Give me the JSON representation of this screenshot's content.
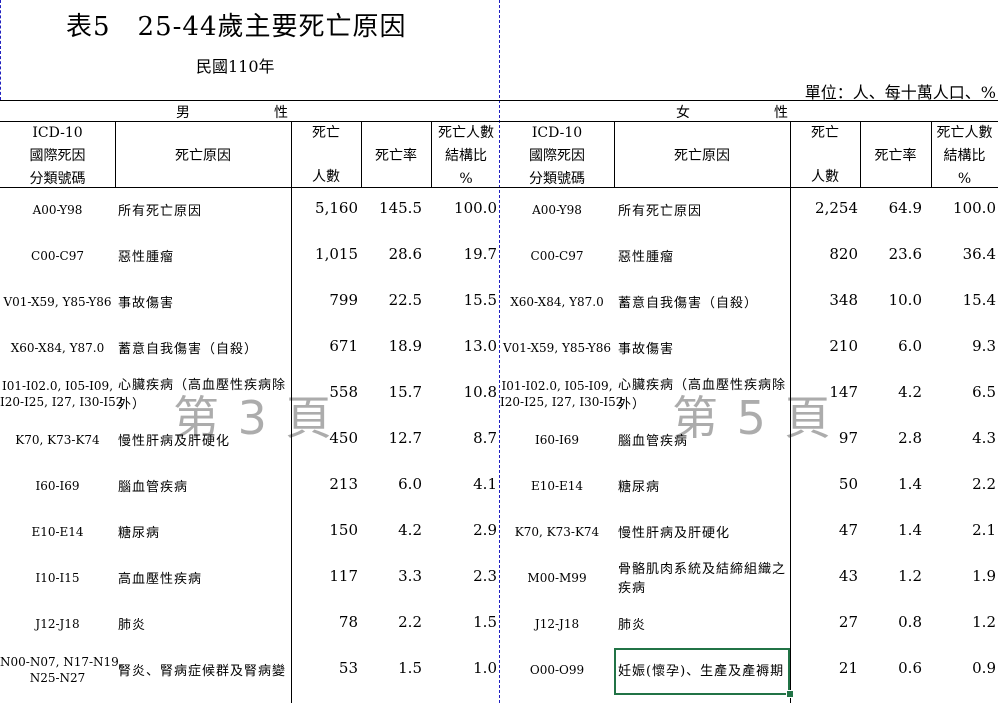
{
  "title": "表5　25-44歲主要死亡原因",
  "subtitle": "民國110年",
  "unit_label": "單位：人、每十萬人口、%",
  "sections": {
    "male_label": "男　　　　　　性",
    "female_label": "女　　　　　　性"
  },
  "headers": {
    "icd": [
      "ICD-10",
      "國際死因",
      "分類號碼"
    ],
    "cause": "死亡原因",
    "deaths": [
      "死亡",
      "人數"
    ],
    "rate": "死亡率",
    "share": [
      "死亡人數",
      "結構比",
      "%"
    ]
  },
  "watermarks": {
    "left": "第 3 頁",
    "right": "第 5 頁"
  },
  "male_rows": [
    {
      "code": [
        "A00-Y98"
      ],
      "cause": [
        "所有死亡原因"
      ],
      "deaths": "5,160",
      "rate": "145.5",
      "share": "100.0"
    },
    {
      "code": [
        "C00-C97"
      ],
      "cause": [
        "惡性腫瘤"
      ],
      "deaths": "1,015",
      "rate": "28.6",
      "share": "19.7"
    },
    {
      "code": [
        "V01-X59, Y85-Y86"
      ],
      "cause": [
        "事故傷害"
      ],
      "deaths": "799",
      "rate": "22.5",
      "share": "15.5"
    },
    {
      "code": [
        "X60-X84, Y87.0"
      ],
      "cause": [
        "蓄意自我傷害（自殺）"
      ],
      "deaths": "671",
      "rate": "18.9",
      "share": "13.0"
    },
    {
      "code": [
        "I01-I02.0, I05-I09,",
        "I20-I25, I27, I30-I52"
      ],
      "cause": [
        "心臟疾病（高血壓性疾病除",
        "外）"
      ],
      "deaths": "558",
      "rate": "15.7",
      "share": "10.8"
    },
    {
      "code": [
        "K70, K73-K74"
      ],
      "cause": [
        "慢性肝病及肝硬化"
      ],
      "deaths": "450",
      "rate": "12.7",
      "share": "8.7"
    },
    {
      "code": [
        "I60-I69"
      ],
      "cause": [
        "腦血管疾病"
      ],
      "deaths": "213",
      "rate": "6.0",
      "share": "4.1"
    },
    {
      "code": [
        "E10-E14"
      ],
      "cause": [
        "糖尿病"
      ],
      "deaths": "150",
      "rate": "4.2",
      "share": "2.9"
    },
    {
      "code": [
        "I10-I15"
      ],
      "cause": [
        "高血壓性疾病"
      ],
      "deaths": "117",
      "rate": "3.3",
      "share": "2.3"
    },
    {
      "code": [
        "J12-J18"
      ],
      "cause": [
        "肺炎"
      ],
      "deaths": "78",
      "rate": "2.2",
      "share": "1.5"
    },
    {
      "code": [
        "N00-N07, N17-N19,",
        "N25-N27"
      ],
      "cause": [
        "腎炎、腎病症候群及腎病變"
      ],
      "deaths": "53",
      "rate": "1.5",
      "share": "1.0"
    }
  ],
  "female_rows": [
    {
      "code": [
        "A00-Y98"
      ],
      "cause": [
        "所有死亡原因"
      ],
      "deaths": "2,254",
      "rate": "64.9",
      "share": "100.0"
    },
    {
      "code": [
        "C00-C97"
      ],
      "cause": [
        "惡性腫瘤"
      ],
      "deaths": "820",
      "rate": "23.6",
      "share": "36.4"
    },
    {
      "code": [
        "X60-X84, Y87.0"
      ],
      "cause": [
        "蓄意自我傷害（自殺）"
      ],
      "deaths": "348",
      "rate": "10.0",
      "share": "15.4"
    },
    {
      "code": [
        "V01-X59, Y85-Y86"
      ],
      "cause": [
        "事故傷害"
      ],
      "deaths": "210",
      "rate": "6.0",
      "share": "9.3"
    },
    {
      "code": [
        "I01-I02.0, I05-I09,",
        "I20-I25, I27, I30-I52"
      ],
      "cause": [
        "心臟疾病（高血壓性疾病除",
        "外）"
      ],
      "deaths": "147",
      "rate": "4.2",
      "share": "6.5"
    },
    {
      "code": [
        "I60-I69"
      ],
      "cause": [
        "腦血管疾病"
      ],
      "deaths": "97",
      "rate": "2.8",
      "share": "4.3"
    },
    {
      "code": [
        "E10-E14"
      ],
      "cause": [
        "糖尿病"
      ],
      "deaths": "50",
      "rate": "1.4",
      "share": "2.2"
    },
    {
      "code": [
        "K70, K73-K74"
      ],
      "cause": [
        "慢性肝病及肝硬化"
      ],
      "deaths": "47",
      "rate": "1.4",
      "share": "2.1"
    },
    {
      "code": [
        "M00-M99"
      ],
      "cause": [
        "骨骼肌肉系統及結締組織之",
        "疾病"
      ],
      "deaths": "43",
      "rate": "1.2",
      "share": "1.9"
    },
    {
      "code": [
        "J12-J18"
      ],
      "cause": [
        "肺炎"
      ],
      "deaths": "27",
      "rate": "0.8",
      "share": "1.2"
    },
    {
      "code": [
        "O00-O99"
      ],
      "cause": [
        "妊娠(懷孕)、生產及產褥期"
      ],
      "deaths": "21",
      "rate": "0.6",
      "share": "0.9"
    }
  ]
}
